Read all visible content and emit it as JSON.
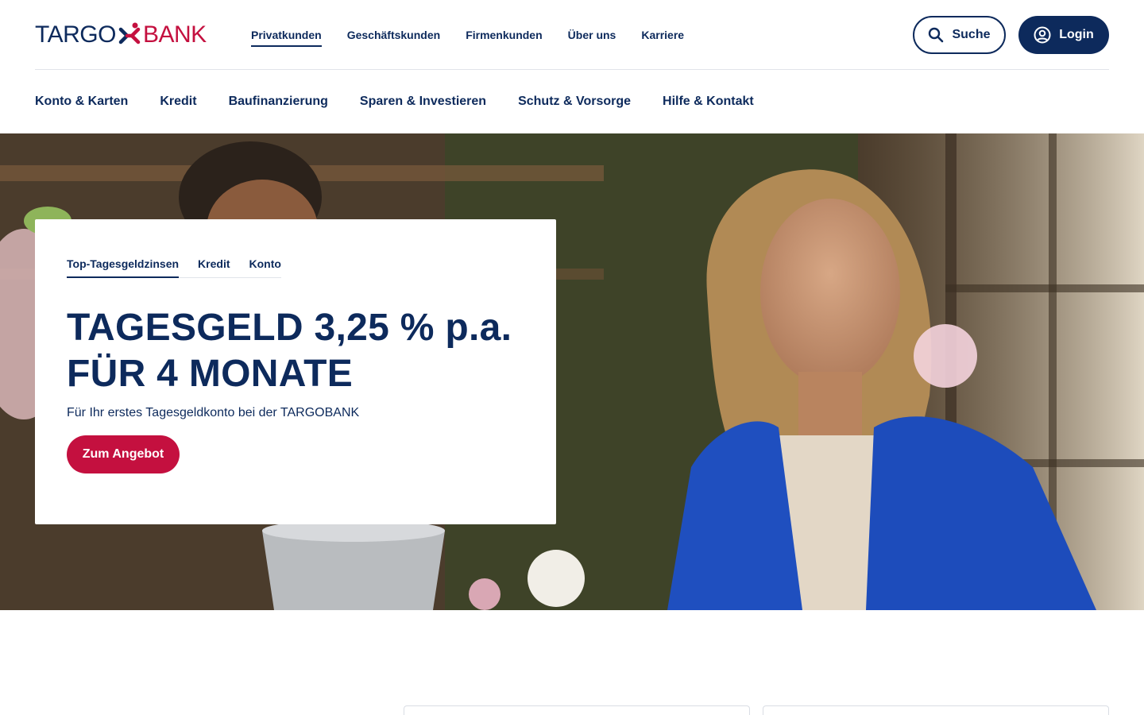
{
  "brand": {
    "name_left": "TARGO",
    "name_right": "BANK",
    "primary_color": "#0d2a5c",
    "accent_color": "#c4103f"
  },
  "segment_nav": {
    "items": [
      {
        "label": "Privatkunden",
        "active": true
      },
      {
        "label": "Geschäftskunden",
        "active": false
      },
      {
        "label": "Firmenkunden",
        "active": false
      },
      {
        "label": "Über uns",
        "active": false
      },
      {
        "label": "Karriere",
        "active": false
      }
    ]
  },
  "actions": {
    "search_label": "Suche",
    "login_label": "Login"
  },
  "main_nav": {
    "items": [
      {
        "label": "Konto & Karten"
      },
      {
        "label": "Kredit"
      },
      {
        "label": "Baufinanzierung"
      },
      {
        "label": "Sparen & Investieren"
      },
      {
        "label": "Schutz & Vorsorge"
      },
      {
        "label": "Hilfe & Kontakt"
      }
    ]
  },
  "offer": {
    "tabs": [
      {
        "label": "Top-Tagesgeldzinsen",
        "active": true
      },
      {
        "label": "Kredit",
        "active": false
      },
      {
        "label": "Konto",
        "active": false
      }
    ],
    "headline_line1": "TAGESGELD 3,25 % p.a.",
    "headline_line2": "FÜR 4 MONATE",
    "subline": "Für Ihr erstes Tagesgeldkonto bei der TARGOBANK",
    "cta_label": "Zum Angebot"
  },
  "icons": {
    "search": "search-icon",
    "login": "user-circle-icon",
    "logo": "targobank-logo-mark"
  }
}
